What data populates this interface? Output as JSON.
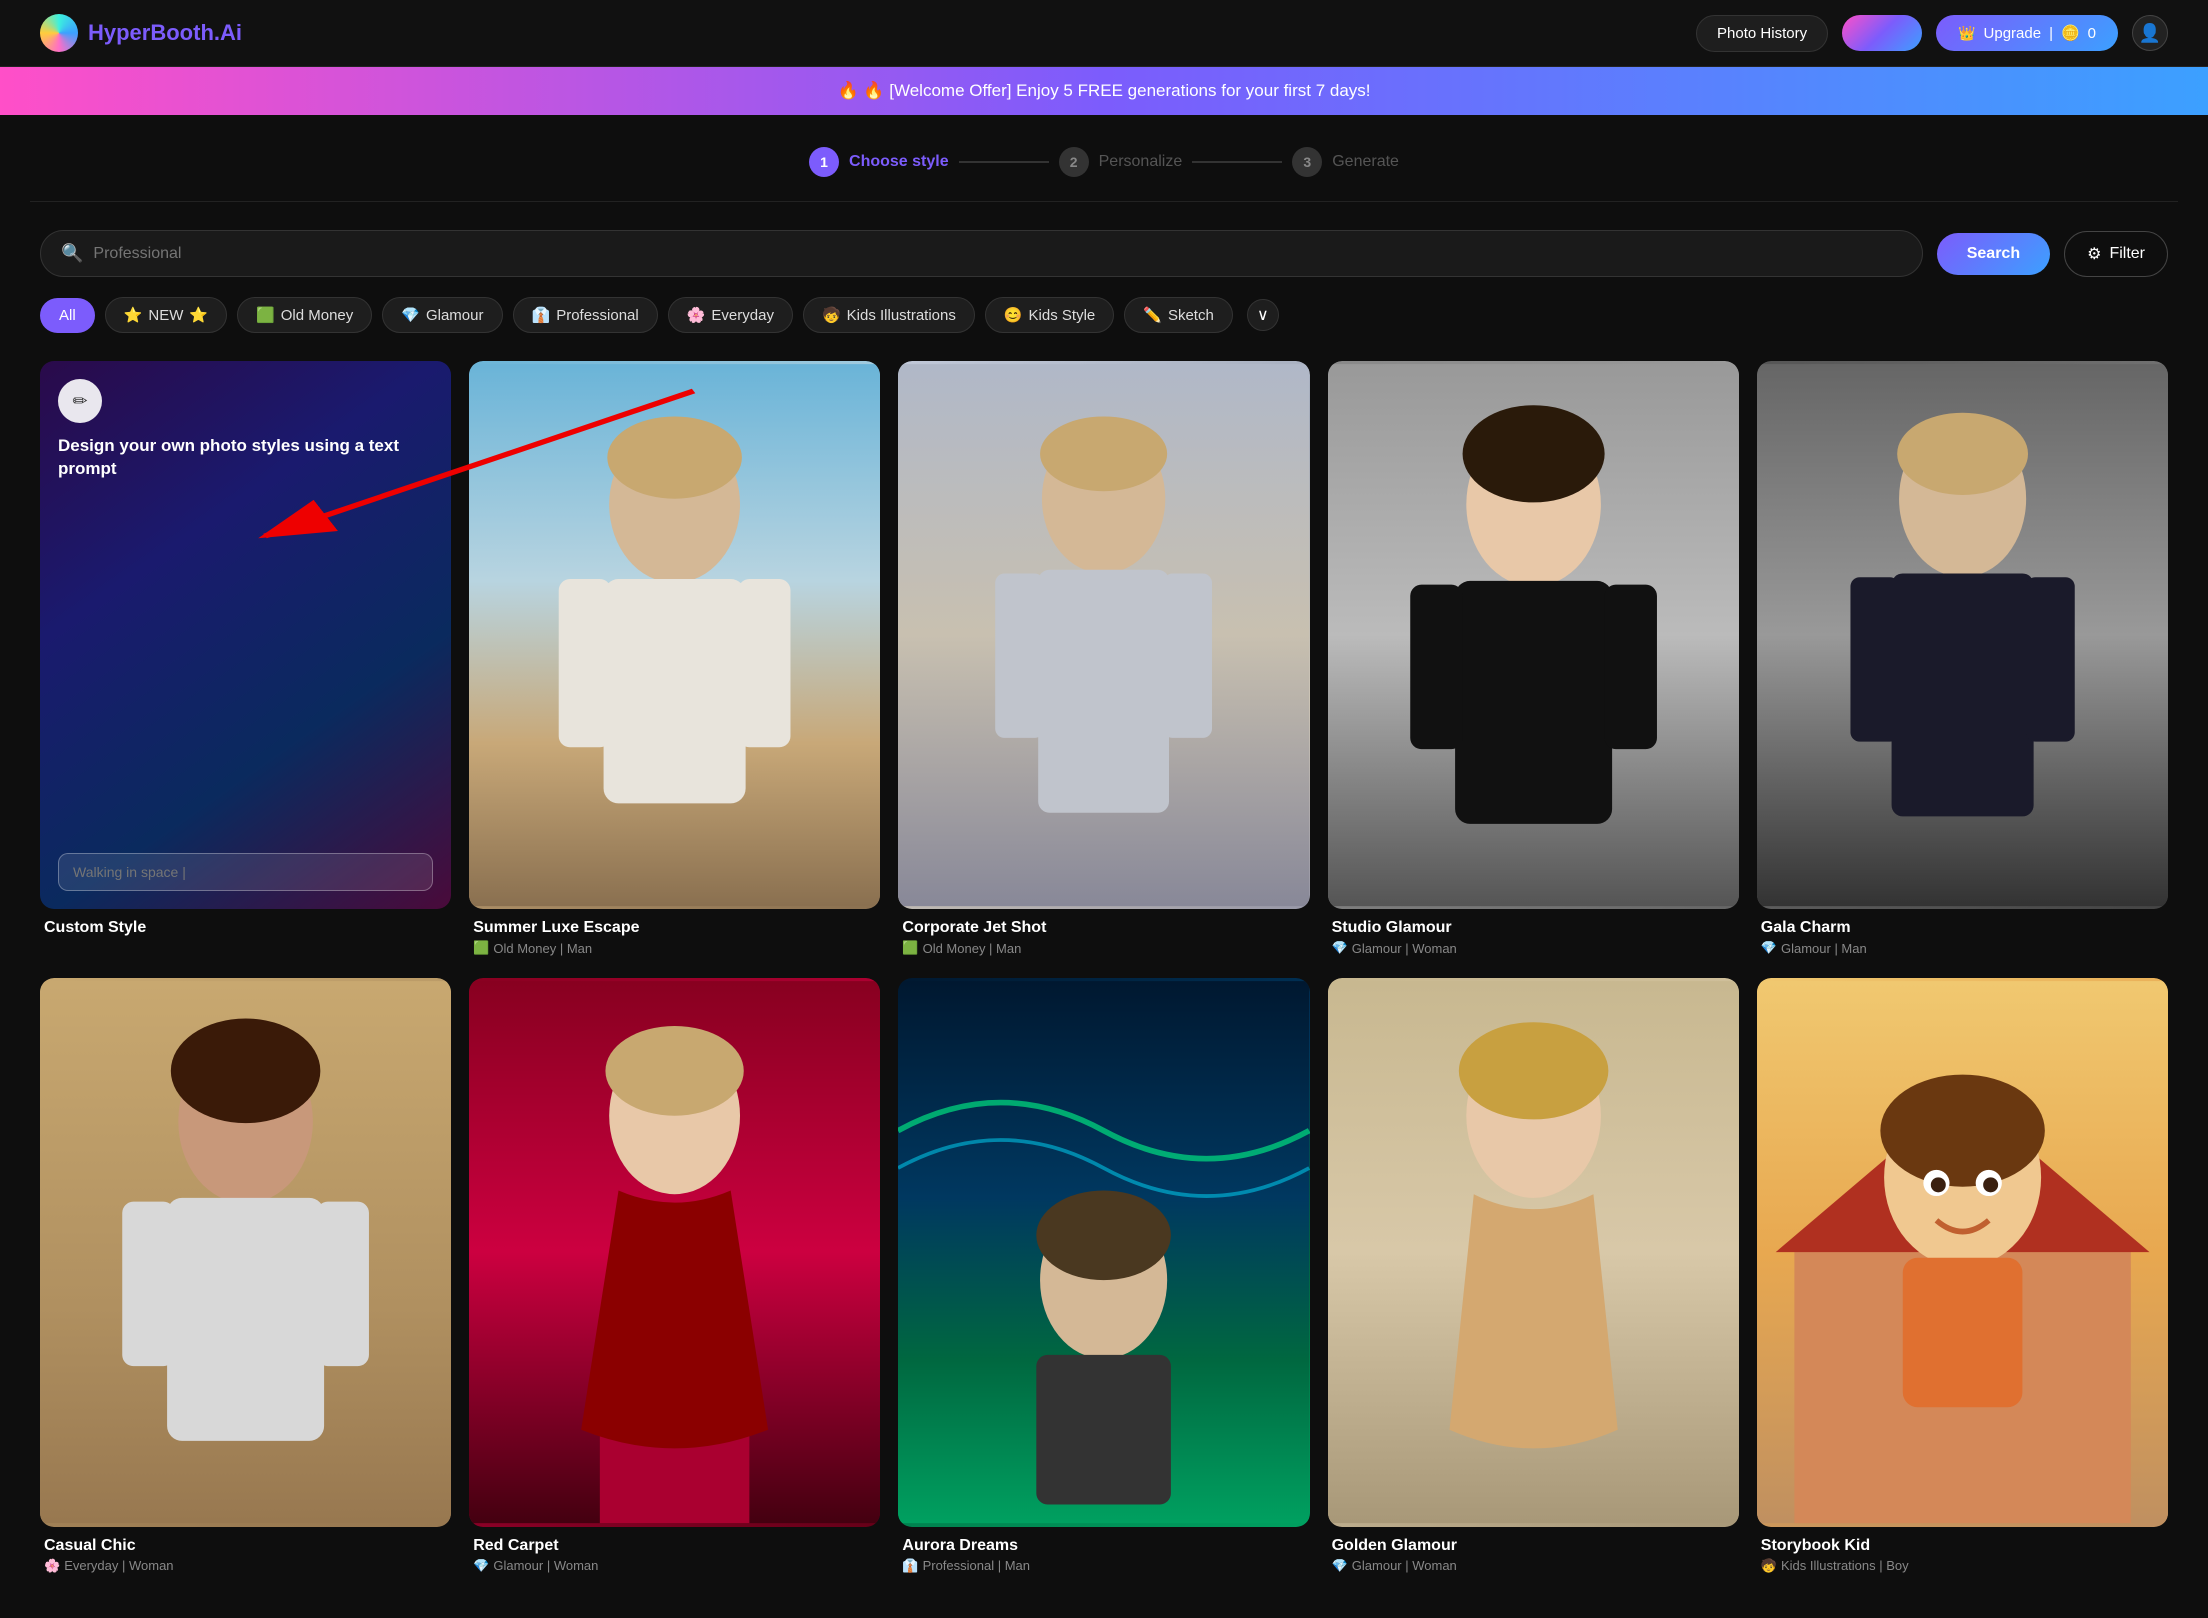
{
  "app": {
    "logo_text": "HyperBooth",
    "logo_suffix": ".Ai"
  },
  "navbar": {
    "photo_history": "Photo History",
    "upgrade_label": "Upgrade",
    "credits": "0",
    "crown_icon": "👑"
  },
  "banner": {
    "text": "🔥 🔥 [Welcome Offer] Enjoy 5 FREE generations for your first 7 days!"
  },
  "stepper": {
    "steps": [
      {
        "num": "1",
        "label": "Choose style",
        "state": "active"
      },
      {
        "num": "2",
        "label": "Personalize",
        "state": "inactive"
      },
      {
        "num": "3",
        "label": "Generate",
        "state": "inactive"
      }
    ]
  },
  "search": {
    "placeholder": "Professional",
    "button_label": "Search",
    "filter_label": "Filter",
    "filter_icon": "⚙"
  },
  "categories": [
    {
      "id": "all",
      "label": "All",
      "emoji": "",
      "active": true
    },
    {
      "id": "new",
      "label": "NEW",
      "emoji": "⭐",
      "active": false
    },
    {
      "id": "old-money",
      "label": "Old Money",
      "emoji": "🟩",
      "active": false
    },
    {
      "id": "glamour",
      "label": "Glamour",
      "emoji": "💎",
      "active": false
    },
    {
      "id": "professional",
      "label": "Professional",
      "emoji": "👔",
      "active": false
    },
    {
      "id": "everyday",
      "label": "Everyday",
      "emoji": "🌸",
      "active": false
    },
    {
      "id": "kids-illustrations",
      "label": "Kids Illustrations",
      "emoji": "🧒",
      "active": false
    },
    {
      "id": "kids-style",
      "label": "Kids Style",
      "emoji": "😊",
      "active": false
    },
    {
      "id": "sketch",
      "label": "Sketch",
      "emoji": "✏️",
      "active": false
    }
  ],
  "custom_card": {
    "desc": "Design your own photo styles using a text prompt",
    "input_placeholder": "Walking in space |",
    "label": "Custom Style",
    "edit_icon": "✏"
  },
  "photo_cards_row1": [
    {
      "id": "summer-luxe",
      "title": "Summer Luxe Escape",
      "subtitle": "Old Money | Man",
      "subtitle_icon": "🟩",
      "img_class": "img-summer"
    },
    {
      "id": "corporate-jet",
      "title": "Corporate Jet Shot",
      "subtitle": "Old Money | Man",
      "subtitle_icon": "🟩",
      "img_class": "img-corporate"
    },
    {
      "id": "studio-glamour",
      "title": "Studio Glamour",
      "subtitle": "Glamour | Woman",
      "subtitle_icon": "💎",
      "img_class": "img-studio-glamour"
    },
    {
      "id": "gala-charm",
      "title": "Gala Charm",
      "subtitle": "Glamour | Man",
      "subtitle_icon": "💎",
      "img_class": "img-gala"
    }
  ],
  "photo_cards_row2": [
    {
      "id": "casual",
      "title": "Casual Chic",
      "subtitle": "Everyday | Woman",
      "subtitle_icon": "🌸",
      "img_class": "img-casual"
    },
    {
      "id": "red-carpet",
      "title": "Red Carpet",
      "subtitle": "Glamour | Woman",
      "subtitle_icon": "💎",
      "img_class": "img-redcarpet"
    },
    {
      "id": "aurora",
      "title": "Aurora Dreams",
      "subtitle": "Professional | Man",
      "subtitle_icon": "👔",
      "img_class": "img-aurora"
    },
    {
      "id": "golden-glamour",
      "title": "Golden Glamour",
      "subtitle": "Glamour | Woman",
      "subtitle_icon": "💎",
      "img_class": "img-glamour2"
    },
    {
      "id": "cartoon-kid",
      "title": "Storybook Kid",
      "subtitle": "Kids Illustrations | Boy",
      "subtitle_icon": "🧒",
      "img_class": "img-cartoon"
    }
  ],
  "arrow": {
    "desc": "Red arrow pointing to custom card"
  }
}
